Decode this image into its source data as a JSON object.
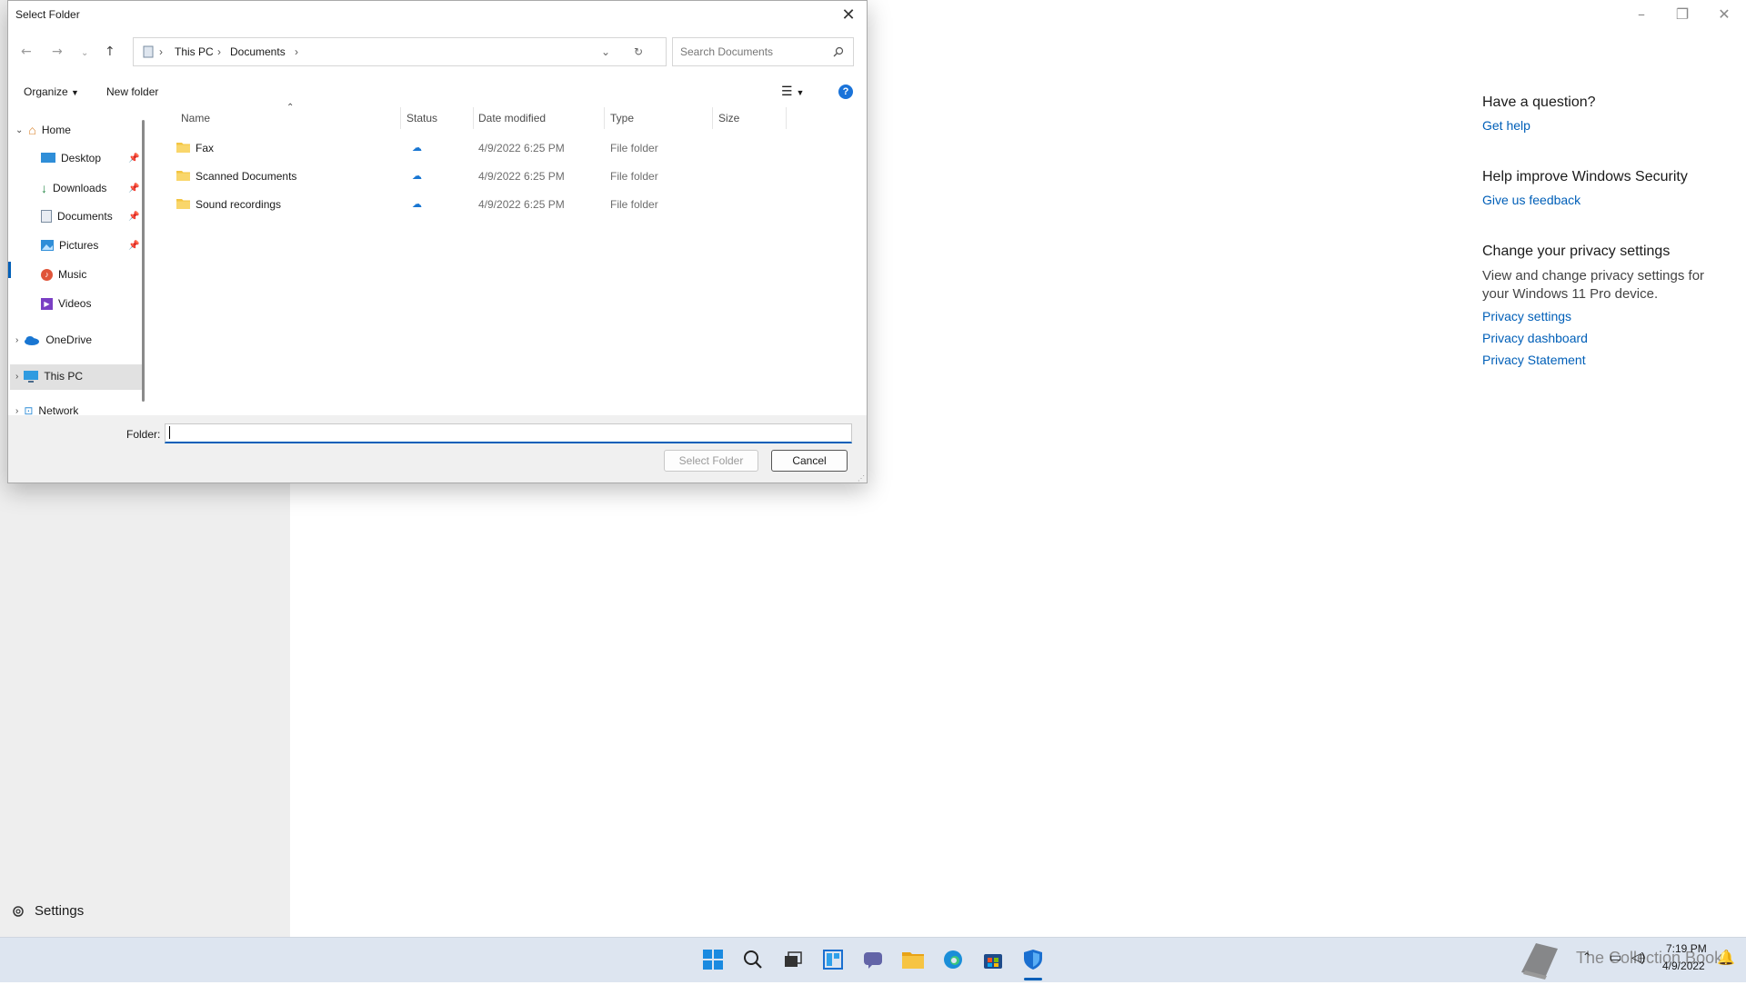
{
  "background_app": {
    "window_controls": {
      "minimize": "–",
      "maximize": "❐",
      "close": "✕"
    },
    "related": {
      "question_heading": "Have a question?",
      "get_help": "Get help",
      "improve_heading": "Help improve Windows Security",
      "feedback": "Give us feedback",
      "privacy_heading": "Change your privacy settings",
      "privacy_text": "View and change privacy settings for your Windows 11 Pro device.",
      "privacy_settings": "Privacy settings",
      "privacy_dashboard": "Privacy dashboard",
      "privacy_statement": "Privacy Statement"
    },
    "settings_label": "Settings"
  },
  "dialog": {
    "title": "Select Folder",
    "close": "✕",
    "breadcrumb": [
      "This PC",
      "Documents"
    ],
    "search_placeholder": "Search Documents",
    "toolbar": {
      "organize": "Organize",
      "new_folder": "New folder",
      "help": "?"
    },
    "tree": {
      "home": "Home",
      "desktop": "Desktop",
      "downloads": "Downloads",
      "documents": "Documents",
      "pictures": "Pictures",
      "music": "Music",
      "videos": "Videos",
      "onedrive": "OneDrive",
      "thispc": "This PC",
      "network": "Network"
    },
    "columns": {
      "name": "Name",
      "status": "Status",
      "date": "Date modified",
      "type": "Type",
      "size": "Size"
    },
    "rows": [
      {
        "name": "Fax",
        "date": "4/9/2022 6:25 PM",
        "type": "File folder"
      },
      {
        "name": "Scanned Documents",
        "date": "4/9/2022 6:25 PM",
        "type": "File folder"
      },
      {
        "name": "Sound recordings",
        "date": "4/9/2022 6:25 PM",
        "type": "File folder"
      }
    ],
    "folder_label": "Folder:",
    "folder_value": "",
    "select_button": "Select Folder",
    "cancel_button": "Cancel"
  },
  "taskbar": {
    "time": "7:19 PM",
    "date": "4/9/2022",
    "watermark": "The Collection Book"
  },
  "colors": {
    "accent": "#005fb8",
    "folder": "#f4c542",
    "taskbar": "#dde5f0"
  }
}
